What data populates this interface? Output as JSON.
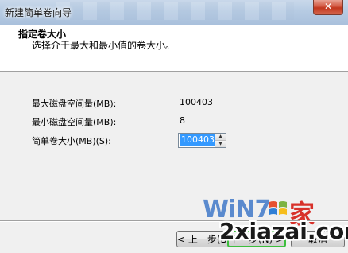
{
  "window": {
    "title": "新建简单卷向导",
    "close_label": "✕"
  },
  "header": {
    "title": "指定卷大小",
    "subtitle": "选择介于最大和最小值的卷大小。"
  },
  "fields": {
    "max": {
      "label": "最大磁盘空间量(MB):",
      "value": "100403"
    },
    "min": {
      "label": "最小磁盘空间量(MB):",
      "value": "8"
    },
    "size": {
      "label": "简单卷大小(MB)(S):",
      "value": "100403"
    }
  },
  "buttons": {
    "back": "< 上一步(B)",
    "next": "下一步(N) >",
    "cancel": "取消"
  },
  "watermark": {
    "brand": "WiN7",
    "jia": "家",
    "site": "2xiazai.com"
  },
  "colors": {
    "selection": "#3399ff",
    "next_button_border": "#3dbf3d",
    "watermark_red": "#d8312a",
    "watermark_blue": "#4078c8"
  },
  "icons": {
    "spin_up": "spin-up-arrow-icon",
    "spin_down": "spin-down-arrow-icon",
    "close": "close-icon",
    "watermark_logo": "windows-flag-icon"
  }
}
